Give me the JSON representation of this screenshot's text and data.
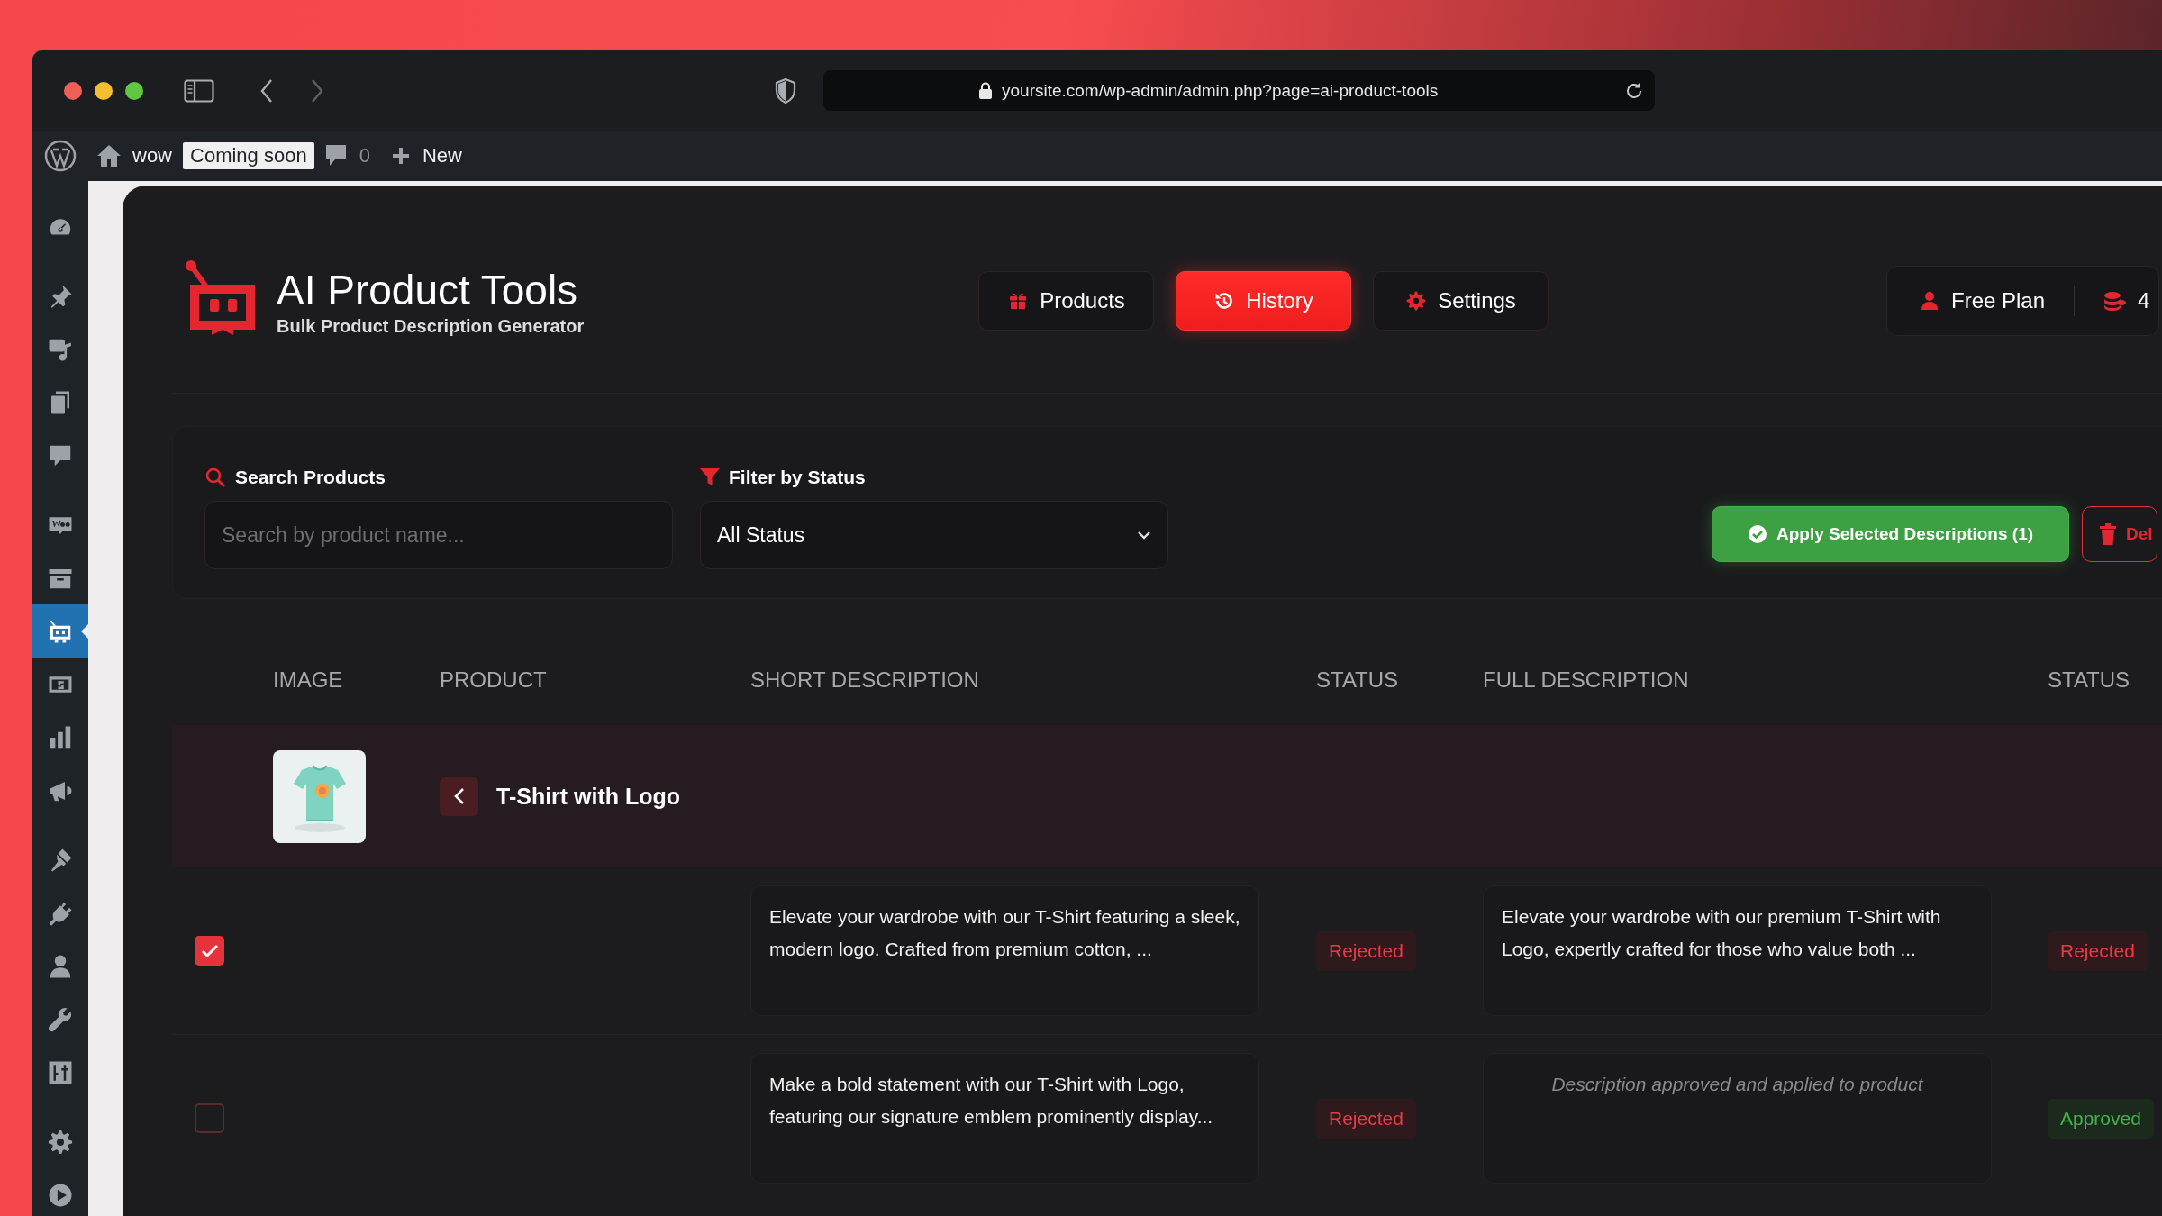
{
  "browser": {
    "url": "yoursite.com/wp-admin/admin.php?page=ai-product-tools"
  },
  "admin_bar": {
    "site_name": "wow",
    "badge": "Coming soon",
    "comments": "0",
    "new_label": "New"
  },
  "sidebar": {
    "groups": [
      {
        "items": [
          {
            "kind": "dashboard",
            "selected": false
          }
        ]
      },
      {
        "items": [
          {
            "kind": "pin",
            "selected": false
          },
          {
            "kind": "media",
            "selected": false
          },
          {
            "kind": "pages",
            "selected": false
          },
          {
            "kind": "comments",
            "selected": false
          }
        ]
      },
      {
        "items": [
          {
            "kind": "store",
            "selected": false
          },
          {
            "kind": "archive",
            "selected": false
          },
          {
            "kind": "robot",
            "selected": true
          },
          {
            "kind": "banknote",
            "selected": false
          },
          {
            "kind": "chart",
            "selected": false
          },
          {
            "kind": "megaphone",
            "selected": false
          }
        ]
      },
      {
        "items": [
          {
            "kind": "brush",
            "selected": false
          },
          {
            "kind": "plug",
            "selected": false
          },
          {
            "kind": "user",
            "selected": false
          },
          {
            "kind": "wrench",
            "selected": false
          },
          {
            "kind": "sliders",
            "selected": false
          }
        ]
      },
      {
        "items": [
          {
            "kind": "gear",
            "selected": false
          },
          {
            "kind": "play",
            "selected": false
          }
        ]
      }
    ]
  },
  "app": {
    "title": "AI Product Tools",
    "subtitle": "Bulk Product Description Generator"
  },
  "nav": [
    {
      "label": "Products",
      "kind": "products",
      "selected": false
    },
    {
      "label": "History",
      "kind": "history",
      "selected": true
    },
    {
      "label": "Settings",
      "kind": "settings",
      "selected": false
    }
  ],
  "plan": {
    "label": "Free Plan",
    "credits": "4"
  },
  "filters": {
    "search_label": "Search Products",
    "search_placeholder": "Search by product name...",
    "status_label": "Filter by Status",
    "status_value": "All Status"
  },
  "actions": [
    {
      "label": "Apply Selected Descriptions (1)",
      "kind": "apply"
    },
    {
      "label": "Del",
      "kind": "delete"
    }
  ],
  "table": {
    "columns": [
      "IMAGE",
      "PRODUCT",
      "SHORT DESCRIPTION",
      "STATUS",
      "FULL DESCRIPTION",
      "STATUS"
    ],
    "groups": [
      {
        "product": "T-Shirt with Logo",
        "image": {
          "kind": "picture"
        },
        "expanded": true,
        "rows": [
          {
            "checked": true,
            "short_description": "Elevate your wardrobe with our T-Shirt featuring a sleek, modern logo. Crafted from premium cotton, ...",
            "short_status": {
              "label": "Rejected",
              "kind": "rejected"
            },
            "full_description": {
              "text": "Elevate your wardrobe with our premium T-Shirt with Logo, expertly crafted for those who value both ...",
              "kind": "text"
            },
            "full_status": {
              "label": "Rejected",
              "kind": "rejected"
            }
          },
          {
            "checked": false,
            "short_description": "Make a bold statement with our T-Shirt with Logo, featuring our signature emblem prominently display...",
            "short_status": {
              "label": "Rejected",
              "kind": "rejected"
            },
            "full_description": {
              "text": "Description approved and applied to product",
              "kind": "note"
            },
            "full_status": {
              "label": "Approved",
              "kind": "approved"
            }
          }
        ]
      }
    ]
  }
}
